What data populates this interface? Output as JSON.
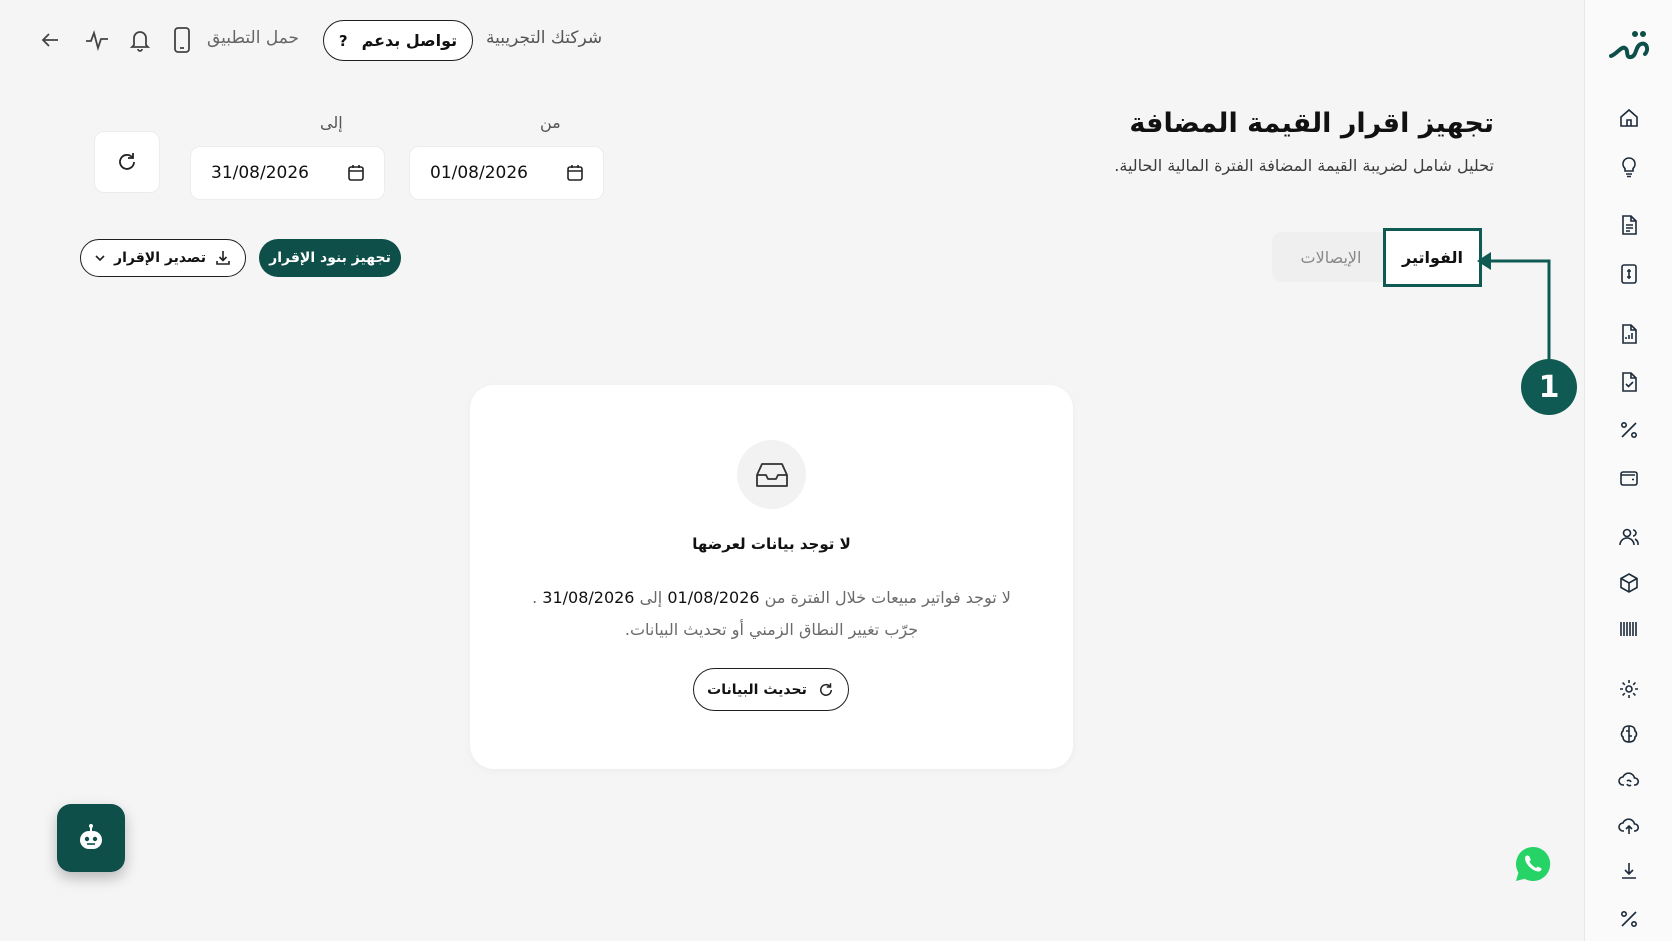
{
  "topbar": {
    "company_name": "شركتك التجريبية",
    "support_label": "تواصل بدعم",
    "support_icon": "?",
    "download_app_label": "حمل التطبيق"
  },
  "header": {
    "title": "تجهيز اقرار القيمة المضافة",
    "subtitle": "تحليل شامل لضريبة القيمة المضافة الفترة المالية الحالية."
  },
  "dates": {
    "from_label": "من",
    "from_value": "01/08/2026",
    "to_label": "إلى",
    "to_value": "31/08/2026"
  },
  "tabs": [
    {
      "label": "الفواتير",
      "active": true
    },
    {
      "label": "الإيصالات",
      "active": false
    }
  ],
  "actions": {
    "prepare_label": "تجهيز بنود الإقرار",
    "export_label": "تصدير الإقرار"
  },
  "annotation": {
    "number": "1",
    "color": "#0f5a52"
  },
  "empty_state": {
    "title": "لا توجد بيانات لعرضها",
    "msg_prefix": "لا توجد فواتير مبيعات خلال الفترة من",
    "msg_from": "01/08/2026",
    "msg_mid": "إلى",
    "msg_to": "31/08/2026",
    "msg_end": ".",
    "msg_line2": "جرّب تغيير النطاق الزمني أو تحديث البيانات.",
    "reload_label": "تحديث البيانات"
  },
  "colors": {
    "brand": "#0e4f4a",
    "background": "#f5f5f5"
  },
  "sidebar_icons": [
    "home-icon",
    "lightbulb-icon",
    "document-icon",
    "invoice-icon",
    "report-icon",
    "file-check-icon",
    "percent-icon",
    "wallet-icon",
    "users-icon",
    "box-icon",
    "barcode-icon",
    "settings-icon",
    "brain-icon",
    "cloud-sync-icon",
    "cloud-upload-icon",
    "download-icon",
    "percent-icon-2"
  ]
}
